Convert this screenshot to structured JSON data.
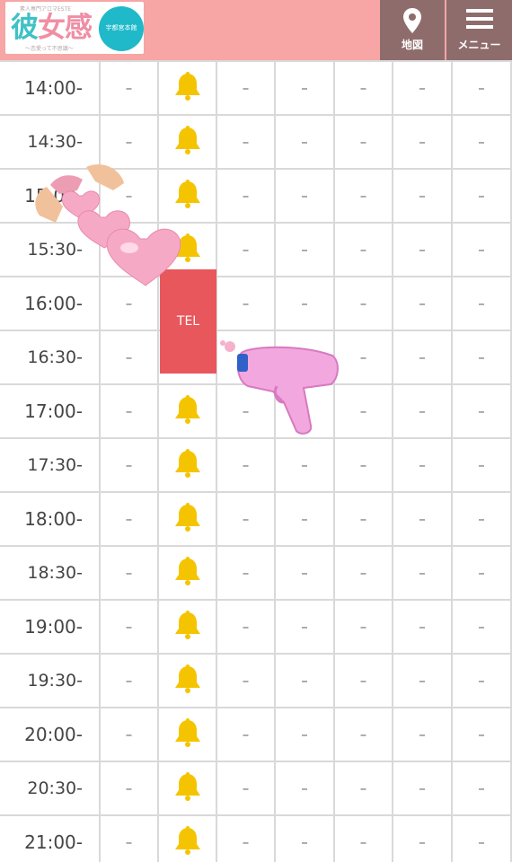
{
  "header": {
    "logo": {
      "top_text": "素人専門アロマESTE",
      "main_text_1": "彼",
      "main_text_2": "女感",
      "sub_text": "〜恋愛って不思議〜",
      "circle_text": "宇都宮本館"
    },
    "map_label": "地図",
    "menu_label": "メニュー"
  },
  "schedule": {
    "dash": "–",
    "tel_label": "TEL",
    "rows": [
      {
        "time": "14:00-",
        "half": false,
        "col2": "bell"
      },
      {
        "time": "14:30-",
        "half": true,
        "col2": "bell"
      },
      {
        "time": "15:00-",
        "half": false,
        "col2": "bell"
      },
      {
        "time": "15:30-",
        "half": true,
        "col2": "bell"
      },
      {
        "time": "16:00-",
        "half": false,
        "col2": "tel"
      },
      {
        "time": "16:30-",
        "half": true,
        "col2": "tel"
      },
      {
        "time": "17:00-",
        "half": false,
        "col2": "bell"
      },
      {
        "time": "17:30-",
        "half": true,
        "col2": "bell"
      },
      {
        "time": "18:00-",
        "half": false,
        "col2": "bell"
      },
      {
        "time": "18:30-",
        "half": true,
        "col2": "bell"
      },
      {
        "time": "19:00-",
        "half": false,
        "col2": "bell"
      },
      {
        "time": "19:30-",
        "half": true,
        "col2": "bell"
      },
      {
        "time": "20:00-",
        "half": false,
        "col2": "bell"
      },
      {
        "time": "20:30-",
        "half": true,
        "col2": "bell"
      },
      {
        "time": "21:00-",
        "half": false,
        "col2": "bell"
      }
    ]
  },
  "colors": {
    "header_bg": "#f7a5a5",
    "header_button_bg": "#8f6c6c",
    "tel_bg": "#e8575c",
    "bell": "#f5c400",
    "grid_line": "#d9d9d9"
  },
  "icons": {
    "map": "map-pin-icon",
    "menu": "hamburger-menu-icon",
    "available": "bell-icon",
    "sticker_1": "heart-hands-sticker",
    "sticker_2": "water-gun-sticker"
  }
}
